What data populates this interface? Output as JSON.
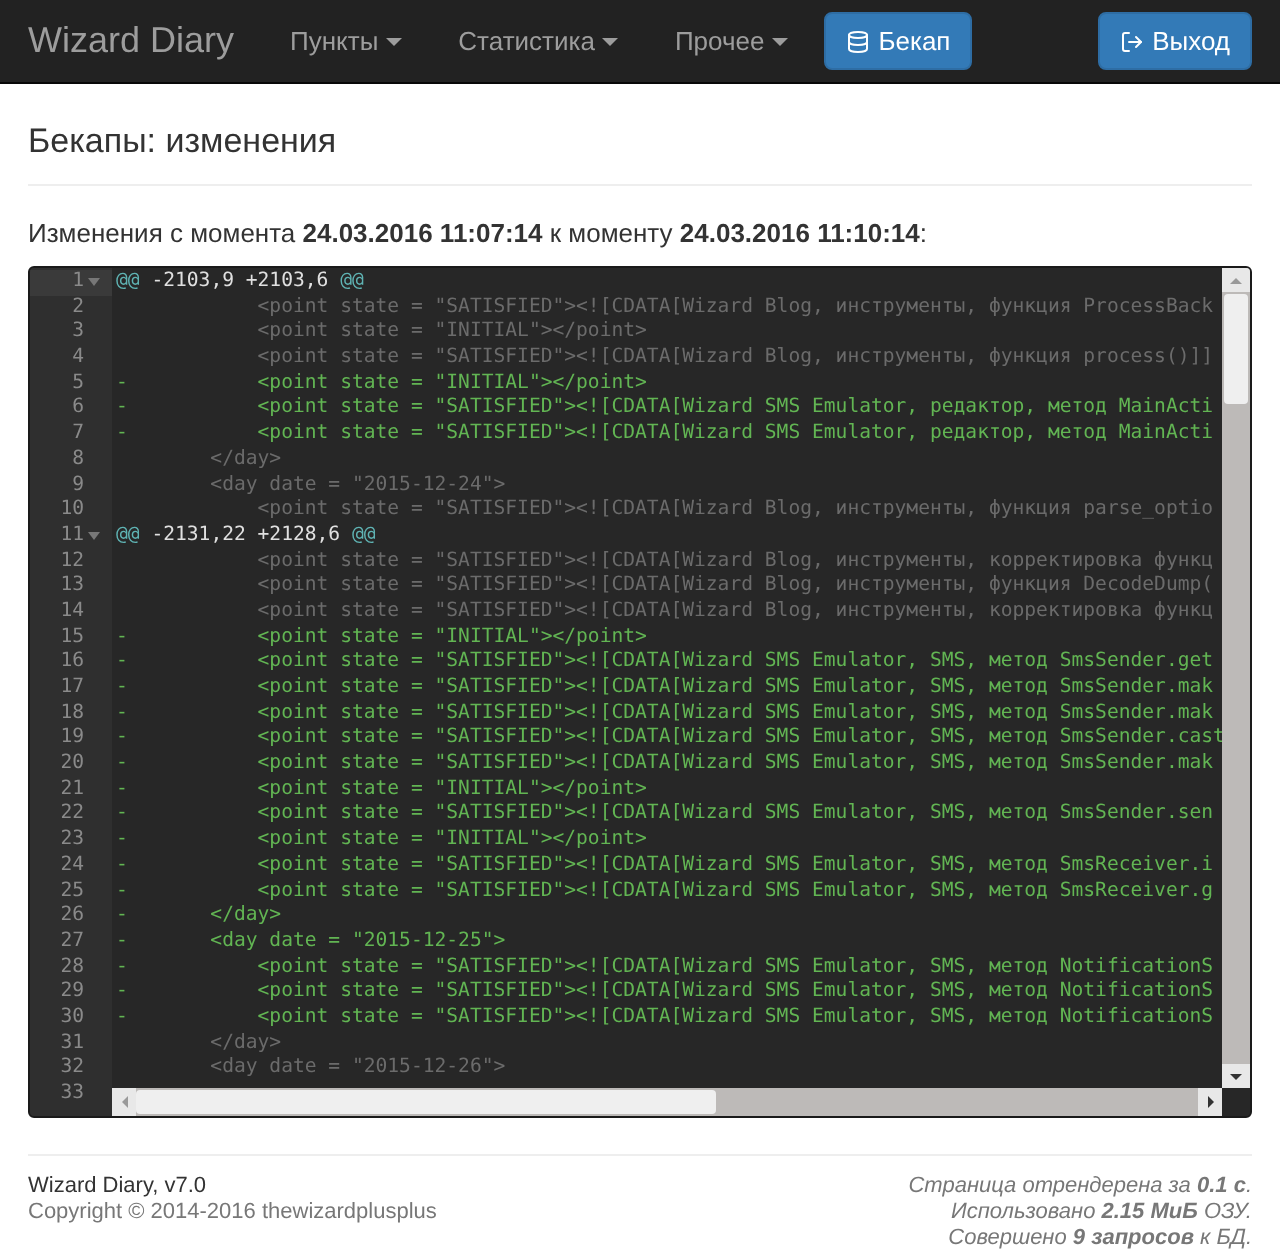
{
  "navbar": {
    "brand": "Wizard Diary",
    "menus": [
      {
        "label": "Пункты"
      },
      {
        "label": "Статистика"
      },
      {
        "label": "Прочее"
      }
    ],
    "backup_button": "Бекап",
    "logout_button": "Выход"
  },
  "page_title": "Бекапы: изменения",
  "summary": "Изменения с момента **24.03.2016 11:07:14** к моменту **24.03.2016 11:10:14**:",
  "editor": {
    "lines": [
      {
        "number": "1",
        "kind": "hunk",
        "marker_open": "@@",
        "range": "-2103,9 +2103,6",
        "marker_close": "@@"
      },
      {
        "number": "2",
        "kind": "context",
        "text": "            <point state = \"SATISFIED\"><![CDATA[Wizard Blog, инструменты, функция ProcessBack"
      },
      {
        "number": "3",
        "kind": "context",
        "text": "            <point state = \"INITIAL\"></point>"
      },
      {
        "number": "4",
        "kind": "context",
        "text": "            <point state = \"SATISFIED\"><![CDATA[Wizard Blog, инструменты, функция process()]]"
      },
      {
        "number": "5",
        "kind": "removed",
        "text": "-           <point state = \"INITIAL\"></point>"
      },
      {
        "number": "6",
        "kind": "removed",
        "text": "-           <point state = \"SATISFIED\"><![CDATA[Wizard SMS Emulator, редактор, метод MainActi"
      },
      {
        "number": "7",
        "kind": "removed",
        "text": "-           <point state = \"SATISFIED\"><![CDATA[Wizard SMS Emulator, редактор, метод MainActi"
      },
      {
        "number": "8",
        "kind": "context",
        "text": "        </day>"
      },
      {
        "number": "9",
        "kind": "context",
        "text": "        <day date = \"2015-12-24\">"
      },
      {
        "number": "10",
        "kind": "context",
        "text": "            <point state = \"SATISFIED\"><![CDATA[Wizard Blog, инструменты, функция parse_optio"
      },
      {
        "number": "11",
        "kind": "hunk",
        "marker_open": "@@",
        "range": "-2131,22 +2128,6",
        "marker_close": "@@"
      },
      {
        "number": "12",
        "kind": "context",
        "text": "            <point state = \"SATISFIED\"><![CDATA[Wizard Blog, инструменты, корректировка функц"
      },
      {
        "number": "13",
        "kind": "context",
        "text": "            <point state = \"SATISFIED\"><![CDATA[Wizard Blog, инструменты, функция DecodeDump("
      },
      {
        "number": "14",
        "kind": "context",
        "text": "            <point state = \"SATISFIED\"><![CDATA[Wizard Blog, инструменты, корректировка функц"
      },
      {
        "number": "15",
        "kind": "removed",
        "text": "-           <point state = \"INITIAL\"></point>"
      },
      {
        "number": "16",
        "kind": "removed",
        "text": "-           <point state = \"SATISFIED\"><![CDATA[Wizard SMS Emulator, SMS, метод SmsSender.get"
      },
      {
        "number": "17",
        "kind": "removed",
        "text": "-           <point state = \"SATISFIED\"><![CDATA[Wizard SMS Emulator, SMS, метод SmsSender.mak"
      },
      {
        "number": "18",
        "kind": "removed",
        "text": "-           <point state = \"SATISFIED\"><![CDATA[Wizard SMS Emulator, SMS, метод SmsSender.mak"
      },
      {
        "number": "19",
        "kind": "removed",
        "text": "-           <point state = \"SATISFIED\"><![CDATA[Wizard SMS Emulator, SMS, метод SmsSender.cast"
      },
      {
        "number": "20",
        "kind": "removed",
        "text": "-           <point state = \"SATISFIED\"><![CDATA[Wizard SMS Emulator, SMS, метод SmsSender.mak"
      },
      {
        "number": "21",
        "kind": "removed",
        "text": "-           <point state = \"INITIAL\"></point>"
      },
      {
        "number": "22",
        "kind": "removed",
        "text": "-           <point state = \"SATISFIED\"><![CDATA[Wizard SMS Emulator, SMS, метод SmsSender.sen"
      },
      {
        "number": "23",
        "kind": "removed",
        "text": "-           <point state = \"INITIAL\"></point>"
      },
      {
        "number": "24",
        "kind": "removed",
        "text": "-           <point state = \"SATISFIED\"><![CDATA[Wizard SMS Emulator, SMS, метод SmsReceiver.i"
      },
      {
        "number": "25",
        "kind": "removed",
        "text": "-           <point state = \"SATISFIED\"><![CDATA[Wizard SMS Emulator, SMS, метод SmsReceiver.g"
      },
      {
        "number": "26",
        "kind": "removed",
        "text": "-       </day>"
      },
      {
        "number": "27",
        "kind": "removed",
        "text": "-       <day date = \"2015-12-25\">"
      },
      {
        "number": "28",
        "kind": "removed",
        "text": "-           <point state = \"SATISFIED\"><![CDATA[Wizard SMS Emulator, SMS, метод NotificationS"
      },
      {
        "number": "29",
        "kind": "removed",
        "text": "-           <point state = \"SATISFIED\"><![CDATA[Wizard SMS Emulator, SMS, метод NotificationS"
      },
      {
        "number": "30",
        "kind": "removed",
        "text": "-           <point state = \"SATISFIED\"><![CDATA[Wizard SMS Emulator, SMS, метод NotificationS"
      },
      {
        "number": "31",
        "kind": "context",
        "text": "        </day>"
      },
      {
        "number": "32",
        "kind": "context",
        "text": "        <day date = \"2015-12-26\">"
      },
      {
        "number": "33",
        "kind": "context"
      }
    ]
  },
  "footer": {
    "app_version": "Wizard Diary, v7.0",
    "copyright": "Copyright © 2014-2016 thewizardplusplus",
    "stats": [
      "Страница отрендерена за **0.1 с**.",
      "Использовано **2.15 МиБ** ОЗУ.",
      "Совершено **9 запросов** к БД."
    ]
  }
}
